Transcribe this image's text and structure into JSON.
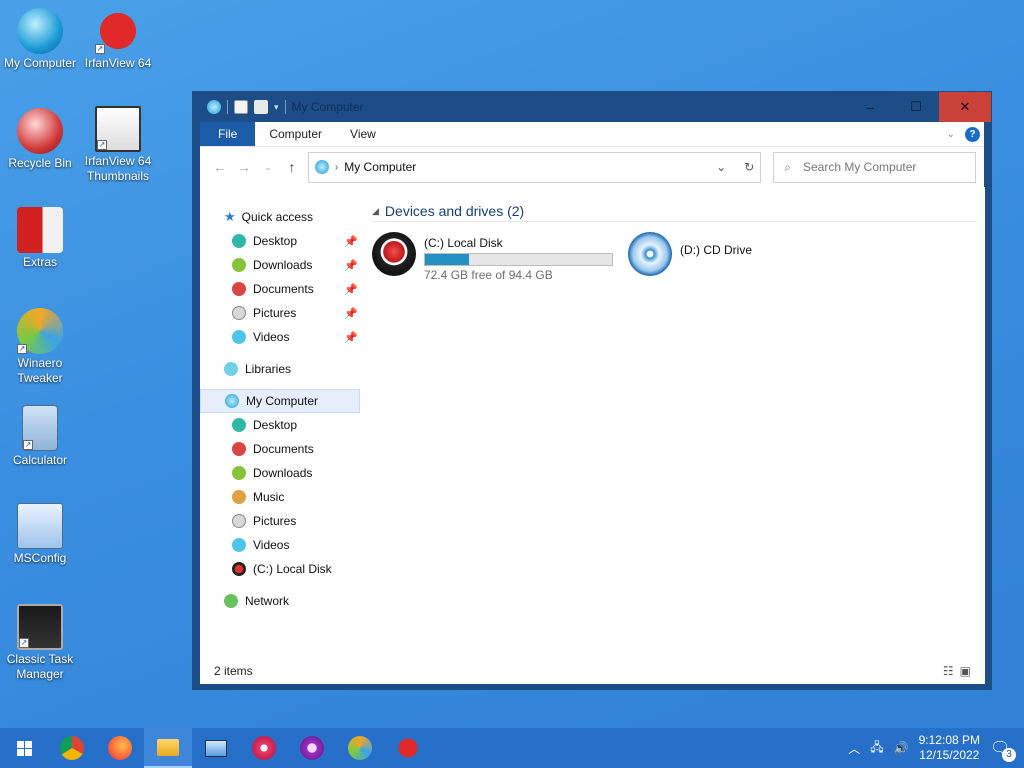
{
  "desktop_icons": [
    {
      "label": "My Computer",
      "icon": "my-computer-icon"
    },
    {
      "label": "IrfanView 64",
      "icon": "irfanview-icon"
    },
    {
      "label": "Recycle Bin",
      "icon": "recycle-bin-icon"
    },
    {
      "label": "IrfanView 64 Thumbnails",
      "icon": "irfanview-thumbnails-icon"
    },
    {
      "label": "Extras",
      "icon": "extras-icon"
    },
    {
      "label": "Winaero Tweaker",
      "icon": "winaero-tweaker-icon"
    },
    {
      "label": "Calculator",
      "icon": "calculator-icon"
    },
    {
      "label": "MSConfig",
      "icon": "msconfig-icon"
    },
    {
      "label": "Classic Task Manager",
      "icon": "task-manager-icon"
    }
  ],
  "window": {
    "title": "My Computer",
    "controls": {
      "minimize": "–",
      "maximize": "☐",
      "close": "✕"
    }
  },
  "ribbon": {
    "tabs": [
      "File",
      "Computer",
      "View"
    ],
    "help": "?"
  },
  "address": {
    "path": "My Computer",
    "search_placeholder": "Search My Computer"
  },
  "nav": {
    "quick_access": {
      "label": "Quick access",
      "items": [
        "Desktop",
        "Downloads",
        "Documents",
        "Pictures",
        "Videos"
      ]
    },
    "libraries": "Libraries",
    "my_computer": {
      "label": "My Computer",
      "items": [
        "Desktop",
        "Documents",
        "Downloads",
        "Music",
        "Pictures",
        "Videos",
        "(C:) Local Disk"
      ]
    },
    "network": "Network"
  },
  "main": {
    "group_title": "Devices and drives (2)",
    "drives": [
      {
        "name": "(C:) Local Disk",
        "free_text": "72.4 GB free of 94.4 GB",
        "used_fraction": 0.233
      },
      {
        "name": "(D:) CD Drive"
      }
    ]
  },
  "status": {
    "items": "2 items"
  },
  "taskbar": {
    "clock_time": "9:12:08 PM",
    "clock_date": "12/15/2022",
    "notification_count": "3"
  },
  "colors": {
    "accent": "#1a5ca8",
    "titlebar": "#1c4d86",
    "close": "#c9423a",
    "taskbar": "#2670c9",
    "progress": "#2491c2"
  }
}
